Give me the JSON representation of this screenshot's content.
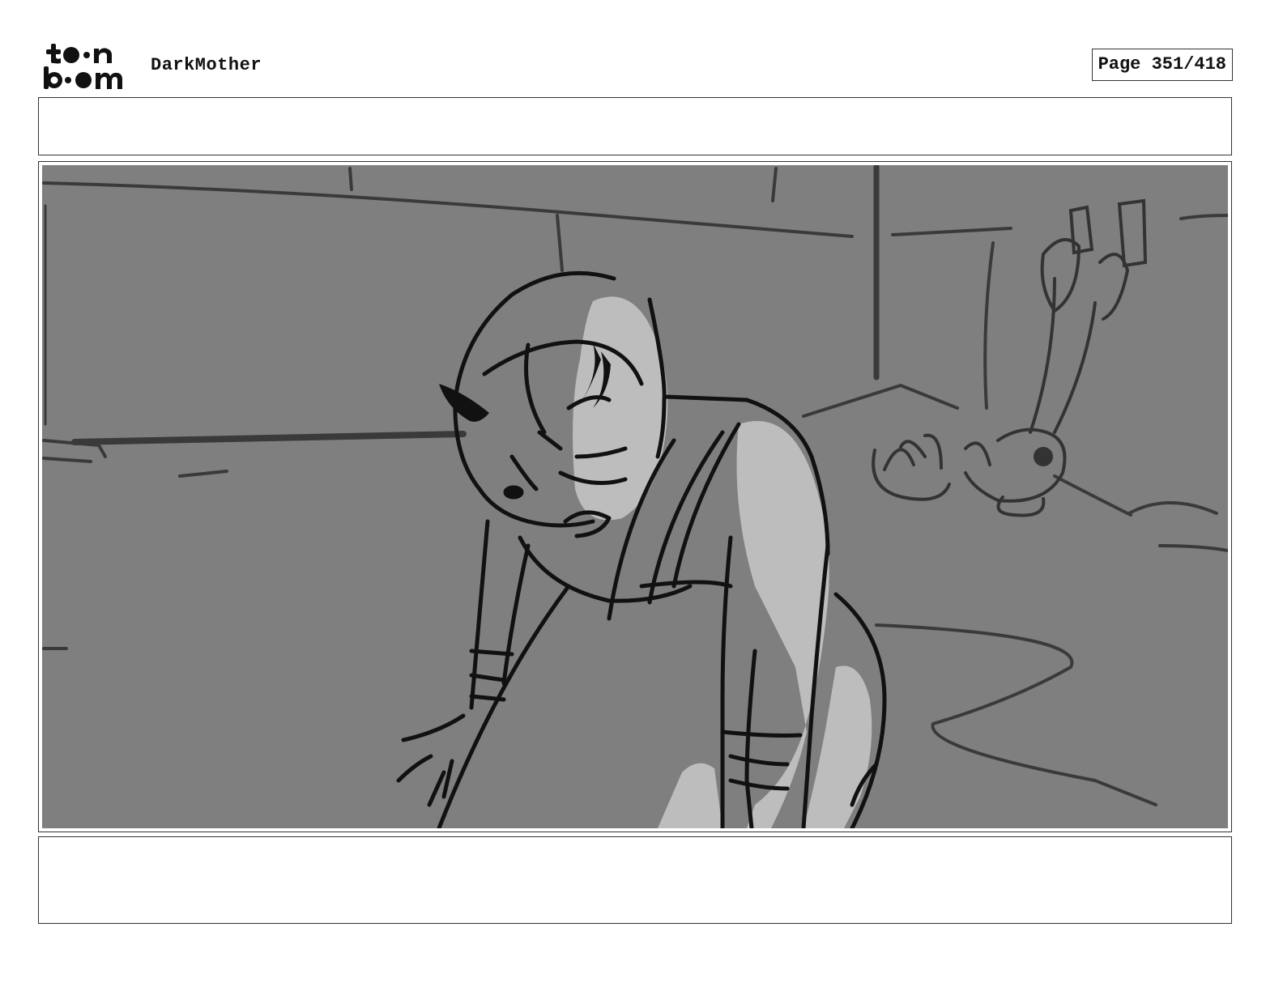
{
  "header": {
    "logo_text": "toon boom",
    "project_title": "DarkMother",
    "page_label": "Page 351/418"
  },
  "panel": {
    "action_notes": "",
    "dialogue_notes": ""
  },
  "colors": {
    "sketch_bg": "#7f7f7f",
    "highlight": "#bdbdbd",
    "line": "#111111",
    "bg_line": "#3a3a3a"
  }
}
